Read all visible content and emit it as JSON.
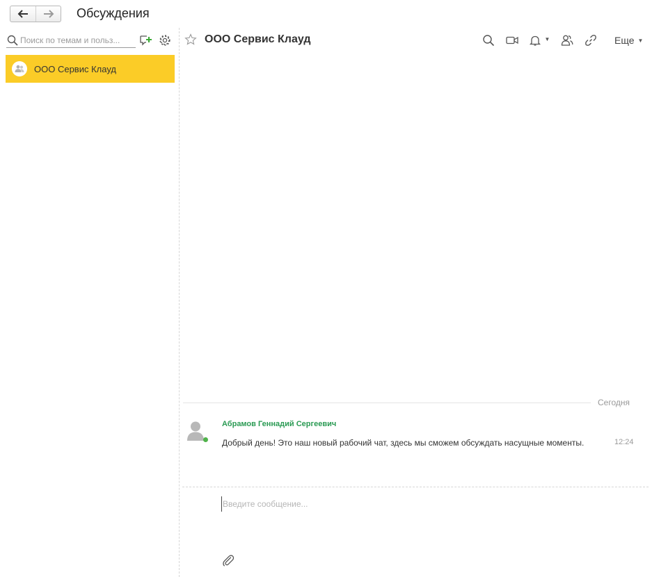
{
  "window": {
    "title": "Обсуждения"
  },
  "nav": {
    "back_icon": "arrow-left-icon",
    "forward_icon": "arrow-right-icon"
  },
  "sidebar": {
    "search_placeholder": "Поиск по темам и польз...",
    "icons": [
      "search-icon",
      "new-chat-icon",
      "gear-icon"
    ],
    "chats": [
      {
        "label": "ООО Сервис Клауд",
        "icon": "group-icon",
        "selected": true
      }
    ]
  },
  "chat": {
    "title": "ООО Сервис Клауд",
    "favorite_icon": "star-icon",
    "header_icons": [
      "search-icon",
      "video-call-icon",
      "bell-icon",
      "members-icon",
      "link-icon"
    ],
    "more_label": "Еще",
    "date_label": "Сегодня",
    "messages": [
      {
        "author": "Абрамов Геннадий Сергеевич",
        "text": "Добрый день! Это наш новый рабочий чат, здесь мы сможем обсуждать насущные моменты.",
        "time": "12:24",
        "online": true
      }
    ],
    "composer_placeholder": "Введите сообщение...",
    "attach_icon": "paperclip-icon"
  },
  "colors": {
    "selected_bg": "#fbcc27",
    "author_green": "#2a9a53",
    "online_green": "#4fb34a",
    "new_chat_plus": "#3aa835"
  }
}
